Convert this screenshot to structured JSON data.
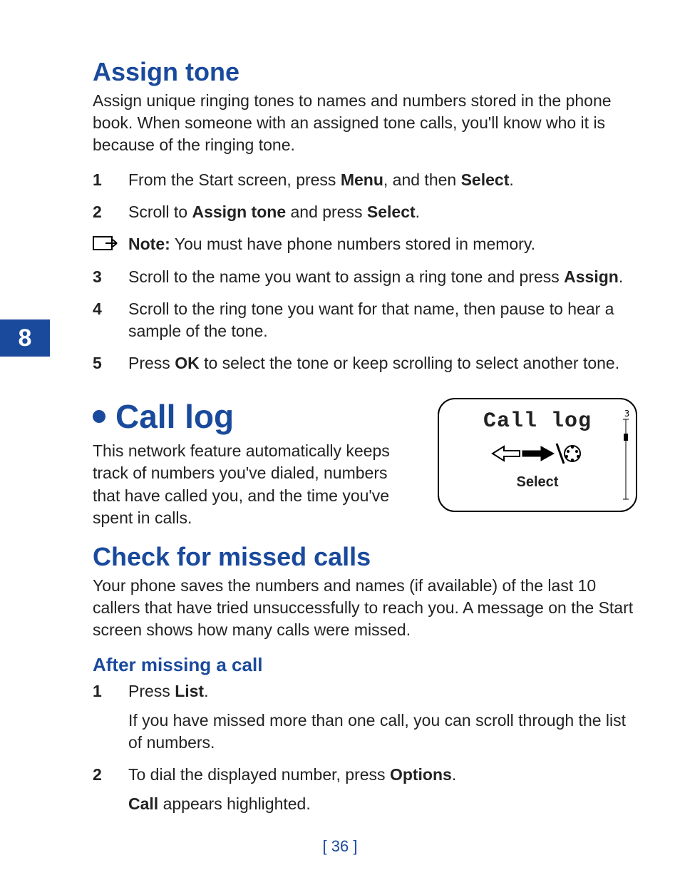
{
  "chapter_number": "8",
  "section_assign_tone": {
    "heading": "Assign tone",
    "intro": "Assign unique ringing tones to names and numbers stored in the phone book. When someone with an assigned tone calls, you'll know who it is because of the ringing tone.",
    "step1_num": "1",
    "step1_a": "From the Start screen, press ",
    "step1_b": "Menu",
    "step1_c": ", and then ",
    "step1_d": "Select",
    "step1_e": ".",
    "step2_num": "2",
    "step2_a": "Scroll to ",
    "step2_b": "Assign tone",
    "step2_c": " and press ",
    "step2_d": "Select",
    "step2_e": ".",
    "note_label": "Note:",
    "note_text": " You must have phone numbers stored in memory.",
    "step3_num": "3",
    "step3_a": "Scroll to the name you want to assign a ring tone and press ",
    "step3_b": "Assign",
    "step3_c": ".",
    "step4_num": "4",
    "step4_text": "Scroll to the ring tone you want for that name, then pause to hear a sample of the tone.",
    "step5_num": "5",
    "step5_a": "Press ",
    "step5_b": "OK",
    "step5_c": " to select the tone or keep scrolling to select another tone."
  },
  "section_call_log": {
    "heading": "Call log",
    "intro": "This network feature automatically keeps track of numbers you've dialed, numbers that have called you, and the time you've spent in calls.",
    "figure_title": "Call log",
    "figure_select": "Select",
    "figure_index": "3"
  },
  "section_missed": {
    "heading": "Check for missed calls",
    "intro": "Your phone saves the numbers and names (if available) of the last 10 callers that have tried unsuccessfully to reach you. A message on the Start screen shows how many calls were missed.",
    "sub_heading": "After missing a call",
    "step1_num": "1",
    "step1_a": "Press ",
    "step1_b": "List",
    "step1_c": ".",
    "step1_p2": "If you have missed more than one call, you can scroll through the list of numbers.",
    "step2_num": "2",
    "step2_a": "To dial the displayed number, press ",
    "step2_b": "Options",
    "step2_c": ".",
    "step2_p2_a": "Call",
    "step2_p2_b": " appears highlighted."
  },
  "page_number": "[ 36 ]"
}
